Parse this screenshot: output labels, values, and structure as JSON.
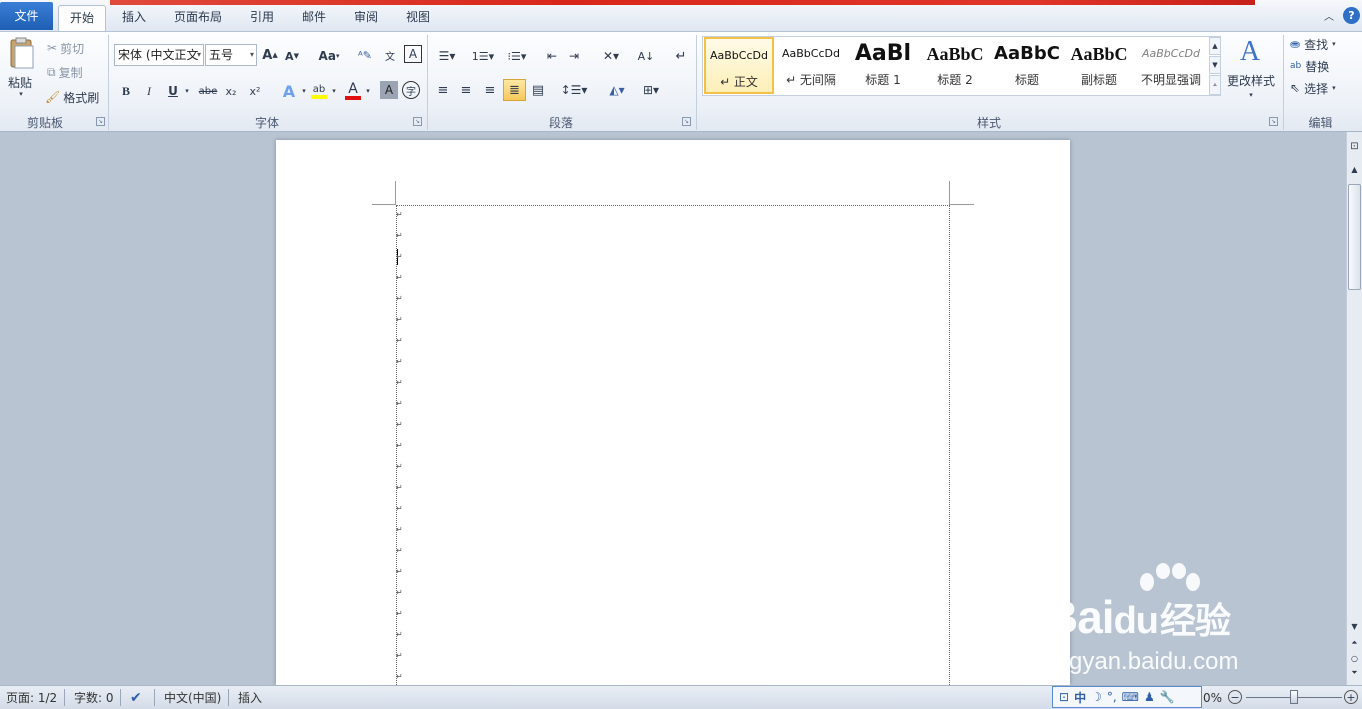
{
  "tabs": {
    "file": "文件",
    "home": "开始",
    "insert": "插入",
    "layout": "页面布局",
    "references": "引用",
    "mailings": "邮件",
    "review": "审阅",
    "view": "视图"
  },
  "clipboard": {
    "paste": "粘贴",
    "cut": "剪切",
    "copy": "复制",
    "format_painter": "格式刷",
    "group": "剪贴板"
  },
  "font": {
    "name": "宋体 (中文正文",
    "size": "五号",
    "change_case": "Aa",
    "bold": "B",
    "italic": "I",
    "underline": "U",
    "strikethrough": "abe",
    "subscript": "x₂",
    "superscript": "x²",
    "font_color": "A",
    "group": "字体"
  },
  "paragraph": {
    "group": "段落"
  },
  "styles": {
    "items": [
      {
        "preview": "AaBbCcDd",
        "name": "↵ 正文"
      },
      {
        "preview": "AaBbCcDd",
        "name": "↵ 无间隔"
      },
      {
        "preview": "AaBl",
        "name": "标题 1"
      },
      {
        "preview": "AaBbC",
        "name": "标题 2"
      },
      {
        "preview": "AaBbC",
        "name": "标题"
      },
      {
        "preview": "AaBbC",
        "name": "副标题"
      },
      {
        "preview": "AaBbCcDd",
        "name": "不明显强调"
      }
    ],
    "change_styles": "更改样式",
    "group": "样式"
  },
  "editing": {
    "find": "查找",
    "replace": "替换",
    "select": "选择",
    "group": "编辑"
  },
  "status": {
    "page": "页面: 1/2",
    "words": "字数: 0",
    "language": "中文(中国)",
    "mode": "插入",
    "zoom": "0%"
  },
  "ime": {
    "lang": "中"
  },
  "watermark": {
    "brand": "Bai",
    "brand2": "du",
    "jingyan": "经验",
    "url": "jingyan.baidu.com"
  },
  "colors": {
    "ribbon_accent": "#1f5fb5",
    "font_color_bar": "#e01010",
    "highlight_bar": "#ffff00"
  }
}
